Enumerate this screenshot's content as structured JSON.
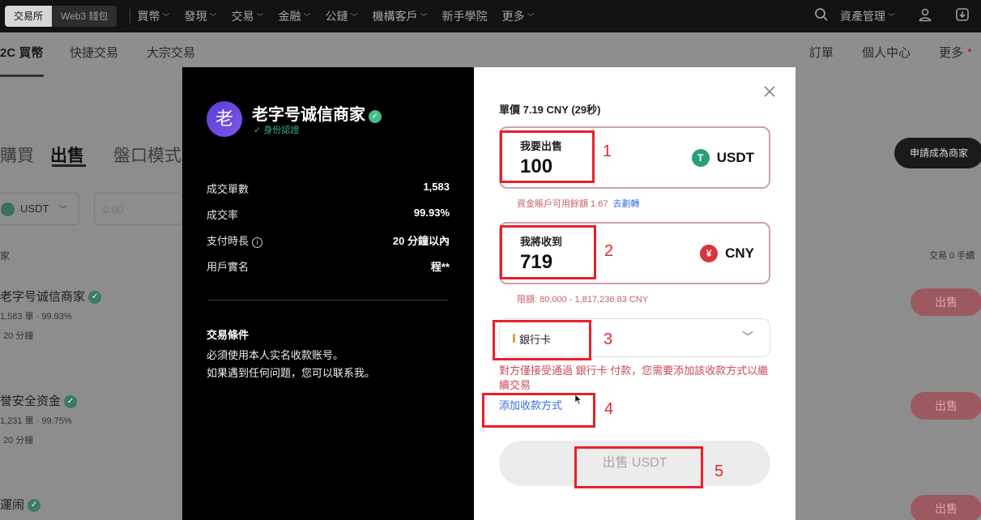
{
  "topnav": {
    "exchange_label": "交易所",
    "web3_label": "Web3 錢包",
    "items": [
      "買幣",
      "發現",
      "交易",
      "金融",
      "公鏈",
      "機構客戶",
      "新手學院",
      "更多"
    ],
    "asset_label": "資產管理"
  },
  "subnav": {
    "tabs": [
      "2C 買幣",
      "快捷交易",
      "大宗交易"
    ],
    "right": [
      "訂單",
      "個人中心",
      "更多"
    ]
  },
  "background": {
    "tabs": [
      "購買",
      "出售",
      "盤口模式"
    ],
    "coin_select": "USDT",
    "amount_placeholder": "0.00",
    "become_merchant": "申請成為商家",
    "col_left": "家",
    "col_right": "交易 0 手續",
    "rows": [
      {
        "name": "老字号诚信商家",
        "meta": "1,583 單 · 99.93%",
        "time": "20 分鐘",
        "action": "出售"
      },
      {
        "name": "誉安全资金",
        "meta": "1,231 單 · 99.75%",
        "time": "20 分鐘",
        "action": "出售"
      },
      {
        "name": "運闹",
        "meta": "",
        "time": "",
        "action": "出售"
      }
    ]
  },
  "merchant": {
    "avatar_char": "老",
    "name": "老字号诚信商家",
    "verified": "身份認證",
    "stats": [
      {
        "label": "成交單數",
        "value": "1,583"
      },
      {
        "label": "成交率",
        "value": "99.93%"
      },
      {
        "label": "支付時長",
        "value": "20 分鐘以內"
      },
      {
        "label": "用戶實名",
        "value": "程**"
      }
    ],
    "terms_title": "交易條件",
    "terms_lines": [
      "必須使用本人实名收款账号。",
      "如果遇到任何问题，您可以联系我。"
    ]
  },
  "order": {
    "price": "單價 7.19 CNY (29秒)",
    "sell_label": "我要出售",
    "sell_amount": "100",
    "sell_coin": "USDT",
    "balance_hint": "資金賬戶可用餘額 1.67",
    "transfer_link": "去劃轉",
    "receive_label": "我將收到",
    "receive_amount": "719",
    "receive_coin": "CNY",
    "limit_hint": "限額: 80,000 - 1,817,236.83 CNY",
    "payment_method": "銀行卡",
    "warning": "對方僅接受通過 銀行卡 付款，您需要添加該收款方式以繼續交易",
    "add_payment": "添加收款方式",
    "submit": "出售 USDT"
  },
  "annotations": [
    "1",
    "2",
    "3",
    "4",
    "5"
  ],
  "colors": {
    "annotation": "#e8202a",
    "usdt": "#26a17b",
    "cny": "#d8343d",
    "link": "#3a6ed8",
    "warning": "#c84a57"
  }
}
